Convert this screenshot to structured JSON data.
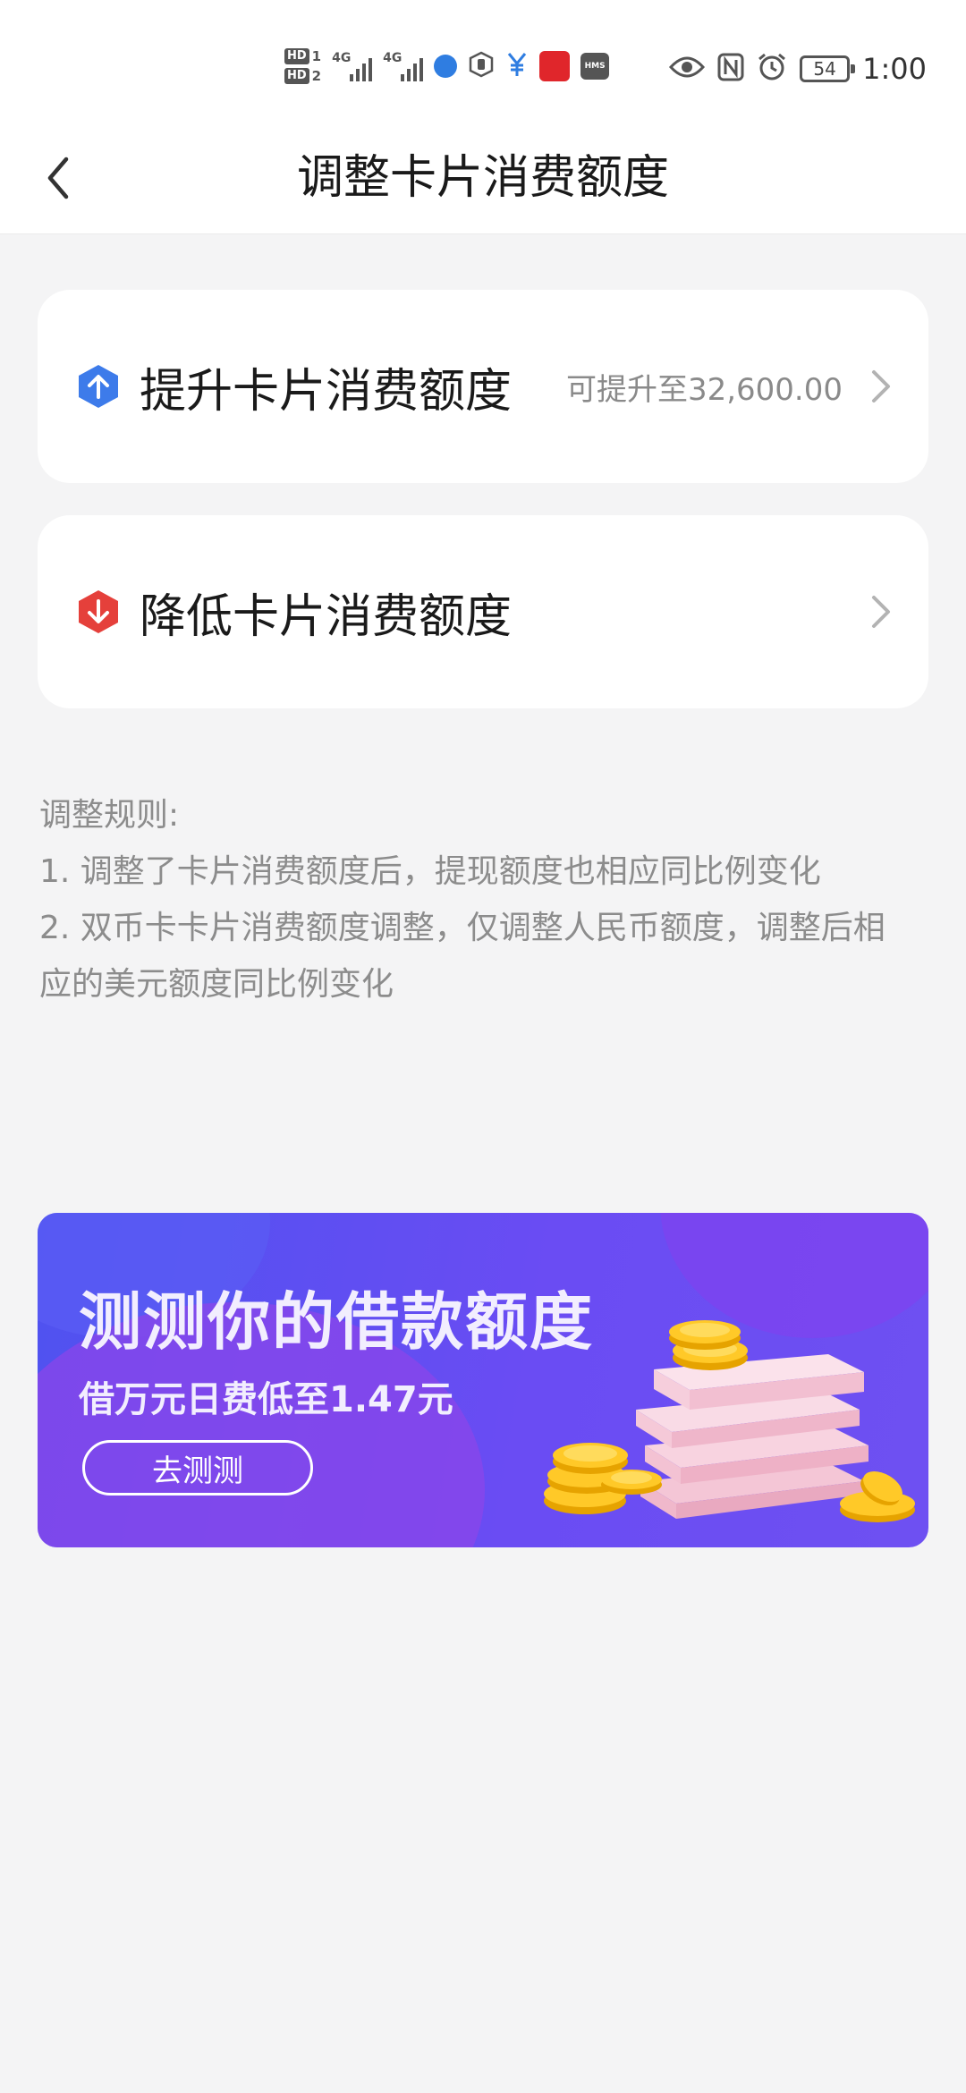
{
  "status_bar": {
    "sim1_label": "HD",
    "sim1_num": "1",
    "sim2_label": "HD",
    "sim2_num": "2",
    "net1": "4G",
    "net2": "4G",
    "hms_label": "HMS",
    "battery": "54",
    "time": "1:00"
  },
  "header": {
    "title": "调整卡片消费额度"
  },
  "cards": {
    "raise": {
      "label": "提升卡片消费额度",
      "sub": "可提升至32,600.00",
      "icon_color": "#3d7bea"
    },
    "lower": {
      "label": "降低卡片消费额度",
      "icon_color": "#e5403b"
    }
  },
  "rules": {
    "heading": "调整规则:",
    "line1": "1. 调整了卡片消费额度后，提现额度也相应同比例变化",
    "line2a": "2. 双币卡卡片消费额度调整，仅调整人民币额度，调整后相",
    "line2b": "应的美元额度同比例变化"
  },
  "banner": {
    "title": "测测你的借款额度",
    "subtitle": "借万元日费低至1.47元",
    "button": "去测测"
  }
}
